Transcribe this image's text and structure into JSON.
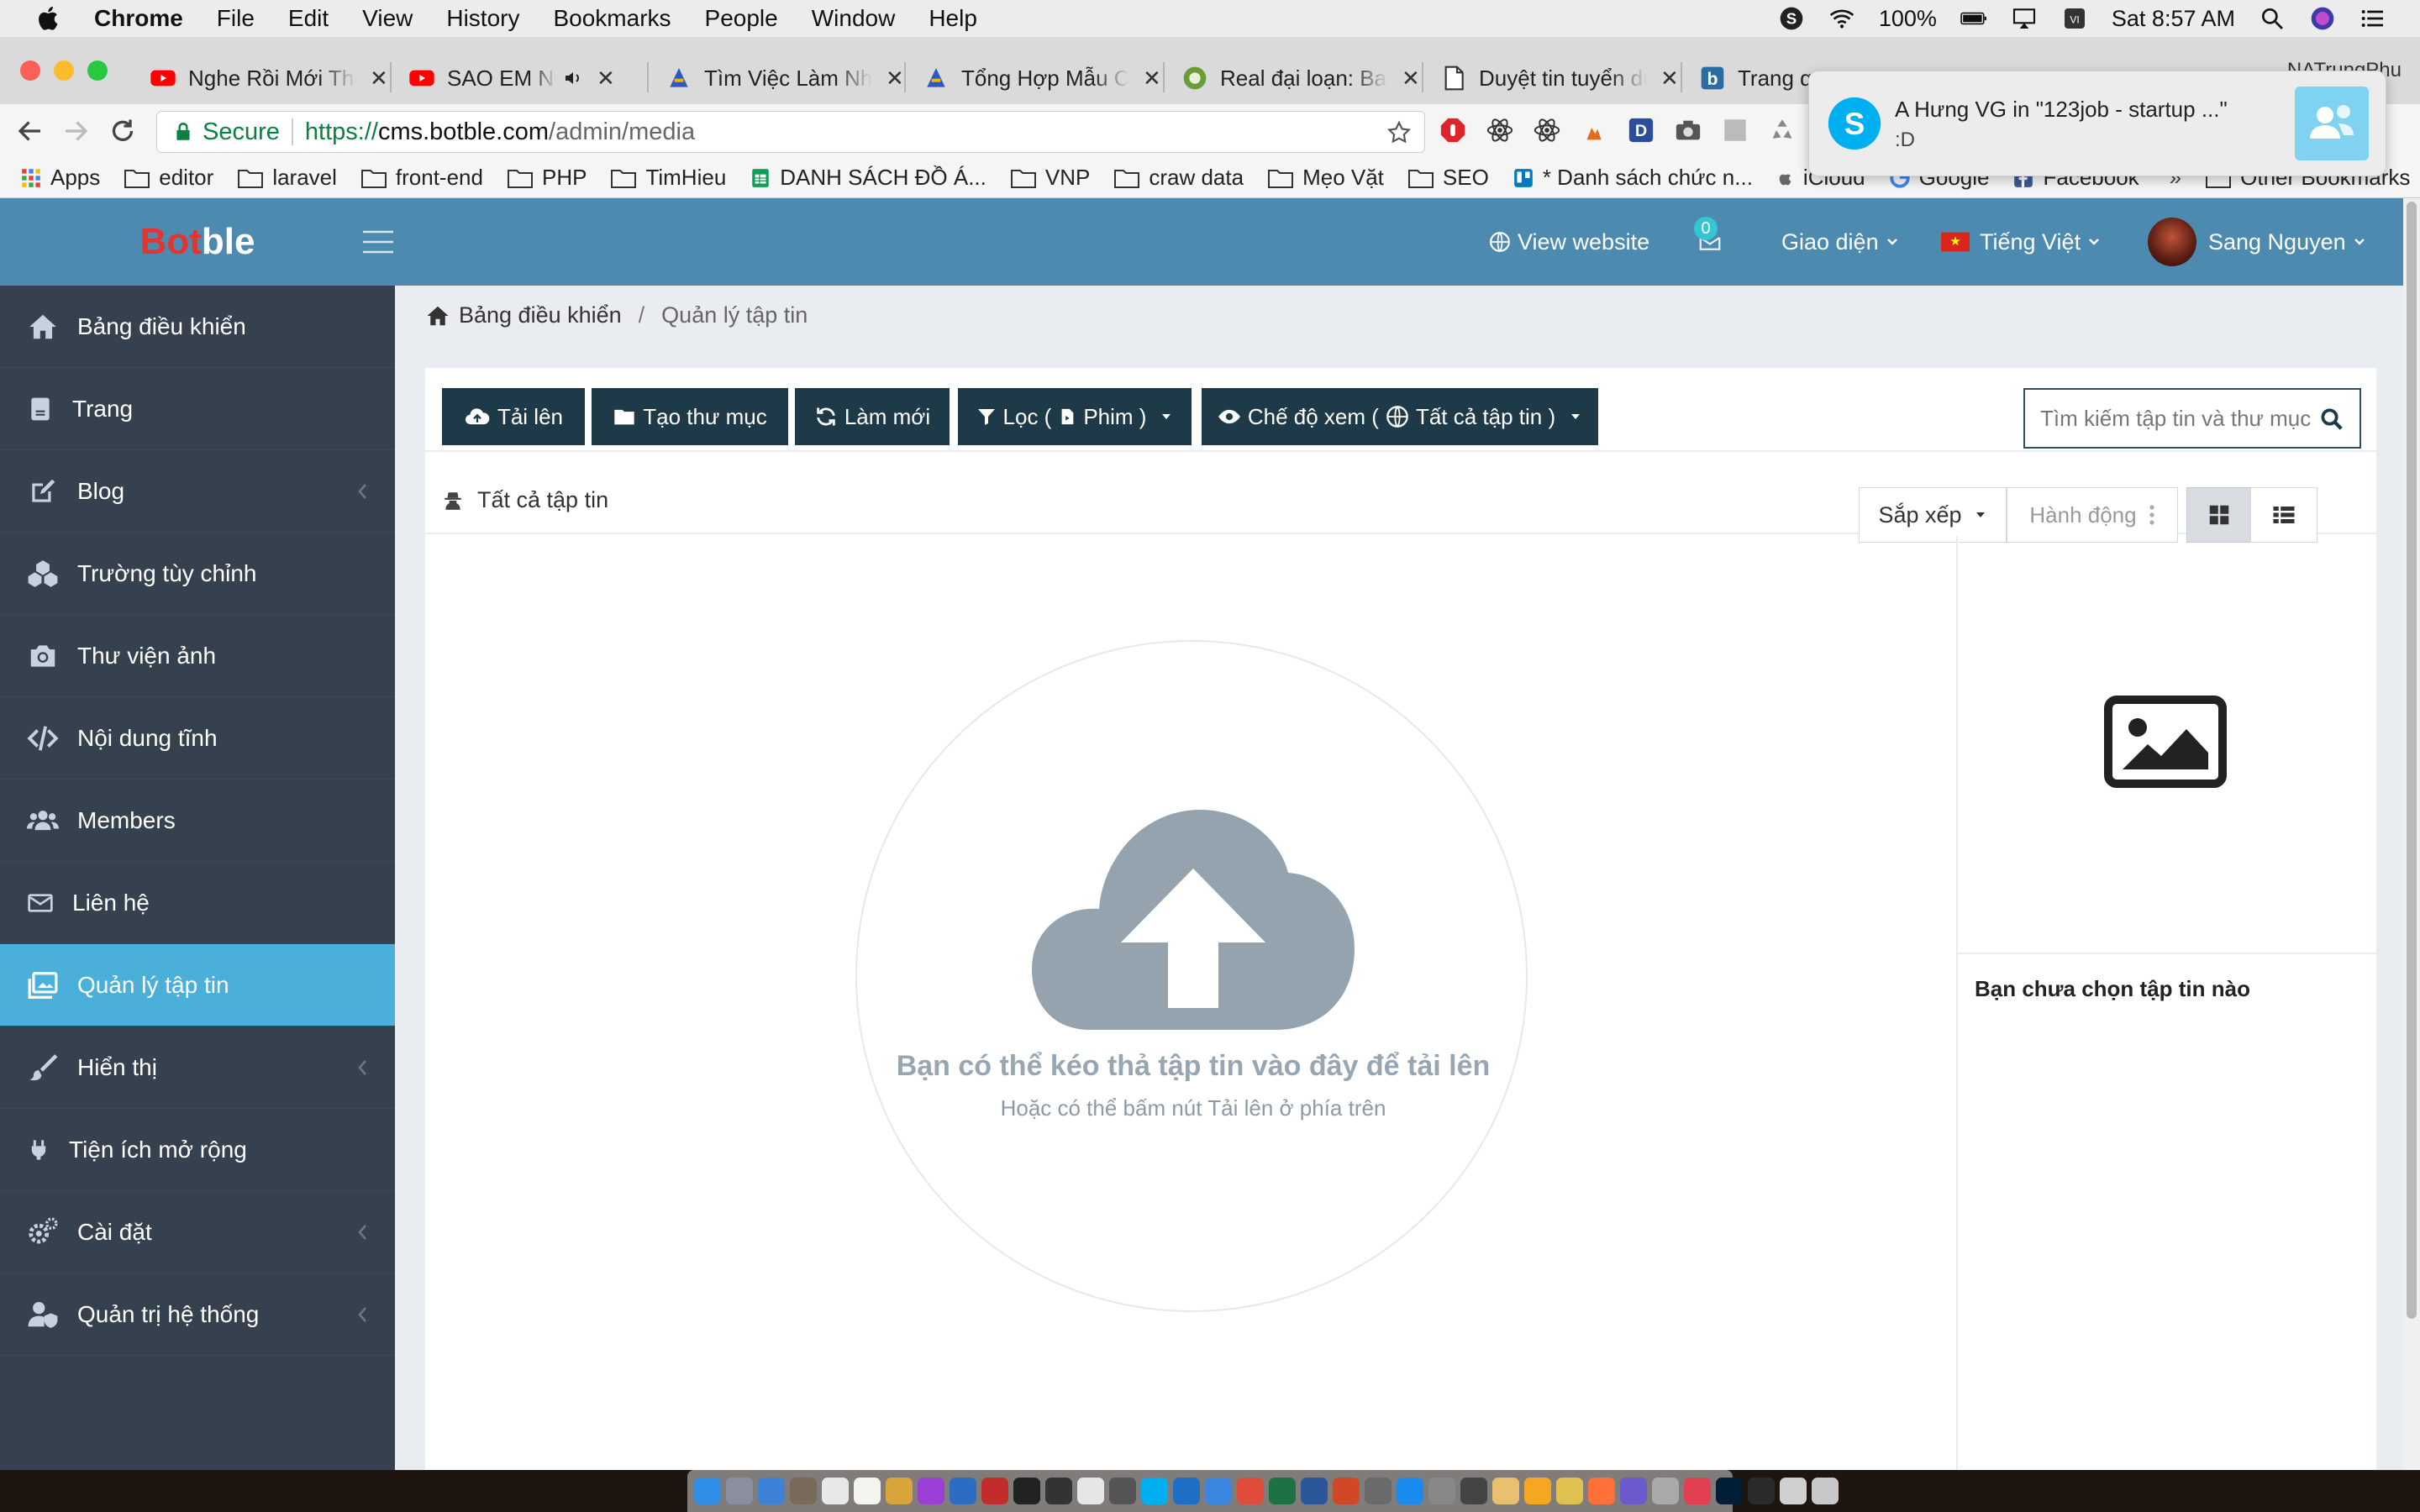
{
  "menubar": {
    "app_name": "Chrome",
    "items": [
      "File",
      "Edit",
      "View",
      "History",
      "Bookmarks",
      "People",
      "Window",
      "Help"
    ],
    "battery": "100%",
    "clock": "Sat 8:57 AM"
  },
  "tabs": [
    {
      "title": "Nghe Rồi Mới Thấy",
      "icon": "youtube-icon"
    },
    {
      "title": "SAO EM NỠ - ...",
      "icon": "youtube-icon"
    },
    {
      "title": "Tìm Việc Làm Nhanh",
      "icon": "123job-icon"
    },
    {
      "title": "Tổng Hợp Mẫu CV",
      "icon": "123job-icon"
    },
    {
      "title": "Real đại loạn: Bale",
      "icon": "globe-icon"
    },
    {
      "title": "Duyệt tin tuyển dụng",
      "icon": "document-icon"
    },
    {
      "title": "Trang q...",
      "icon": "botble-icon"
    }
  ],
  "profile_name": "NATrungPhu",
  "address": {
    "secure_label": "Secure",
    "scheme": "https://",
    "host": "cms.botble.com",
    "path": "/admin/media"
  },
  "bookmarks": [
    {
      "label": "Apps",
      "icon": "apps-grid-icon"
    },
    {
      "label": "editor",
      "icon": "folder-icon"
    },
    {
      "label": "laravel",
      "icon": "folder-icon"
    },
    {
      "label": "front-end",
      "icon": "folder-icon"
    },
    {
      "label": "PHP",
      "icon": "folder-icon"
    },
    {
      "label": "TimHieu",
      "icon": "folder-icon"
    },
    {
      "label": "DANH SÁCH ĐỒ Á...",
      "icon": "sheets-icon"
    },
    {
      "label": "VNP",
      "icon": "folder-icon"
    },
    {
      "label": "craw data",
      "icon": "folder-icon"
    },
    {
      "label": "Mẹo Vặt",
      "icon": "folder-icon"
    },
    {
      "label": "SEO",
      "icon": "folder-icon"
    },
    {
      "label": "* Danh sách chức n...",
      "icon": "trello-icon"
    },
    {
      "label": "iCloud",
      "icon": "apple-icon"
    },
    {
      "label": "Google",
      "icon": "google-icon"
    },
    {
      "label": "Facebook",
      "icon": "facebook-icon"
    },
    {
      "label": "Other Bookmarks",
      "icon": "folder-icon"
    }
  ],
  "notification": {
    "title": "A Hưng VG in \"123job - startup ...\"",
    "body": ":D"
  },
  "header": {
    "logo_part1": "Bot",
    "logo_part2": "ble",
    "view_website": "View website",
    "mail_count": "0",
    "theme_menu": "Giao diện",
    "language": "Tiếng Việt",
    "user_name": "Sang Nguyen"
  },
  "sidebar": {
    "items": [
      {
        "label": "Bảng điều khiển",
        "icon": "home-icon",
        "has_children": false,
        "active": false
      },
      {
        "label": "Trang",
        "icon": "page-icon",
        "has_children": false,
        "active": false
      },
      {
        "label": "Blog",
        "icon": "edit-icon",
        "has_children": true,
        "active": false
      },
      {
        "label": "Trường tùy chỉnh",
        "icon": "cubes-icon",
        "has_children": false,
        "active": false
      },
      {
        "label": "Thư viện ảnh",
        "icon": "camera-icon",
        "has_children": false,
        "active": false
      },
      {
        "label": "Nội dung tĩnh",
        "icon": "code-icon",
        "has_children": false,
        "active": false
      },
      {
        "label": "Members",
        "icon": "users-icon",
        "has_children": false,
        "active": false
      },
      {
        "label": "Liên hệ",
        "icon": "envelope-icon",
        "has_children": false,
        "active": false
      },
      {
        "label": "Quản lý tập tin",
        "icon": "images-icon",
        "has_children": false,
        "active": true
      },
      {
        "label": "Hiển thị",
        "icon": "brush-icon",
        "has_children": true,
        "active": false
      },
      {
        "label": "Tiện ích mở rộng",
        "icon": "plug-icon",
        "has_children": false,
        "active": false
      },
      {
        "label": "Cài đặt",
        "icon": "cogs-icon",
        "has_children": true,
        "active": false
      },
      {
        "label": "Quản trị hệ thống",
        "icon": "user-shield-icon",
        "has_children": true,
        "active": false
      }
    ]
  },
  "breadcrumb": {
    "home": "Bảng điều khiển",
    "current": "Quản lý tập tin"
  },
  "media": {
    "upload": "Tải lên",
    "create_folder": "Tạo thư mục",
    "refresh": "Làm mới",
    "filter_prefix": "Lọc (",
    "filter_value": "Phim )",
    "view_mode_prefix": "Chế độ xem (",
    "view_mode_value": "Tất cả tập tin )",
    "search_placeholder": "Tìm kiếm tập tin và thư mục",
    "all_files": "Tất cả tập tin",
    "sort": "Sắp xếp",
    "actions": "Hành động",
    "drop_title": "Bạn có thể kéo thả tập tin vào đây để tải lên",
    "drop_subtitle": "Hoặc có thể bấm nút Tải lên ở phía trên",
    "no_selection": "Bạn chưa chọn tập tin nào"
  },
  "colors": {
    "header_bg": "#4d8ab0",
    "sidebar_bg": "#364150",
    "sidebar_active": "#4ab0d9",
    "toolbar_button_bg": "#1e3a48",
    "logo_accent": "#e3342f"
  }
}
